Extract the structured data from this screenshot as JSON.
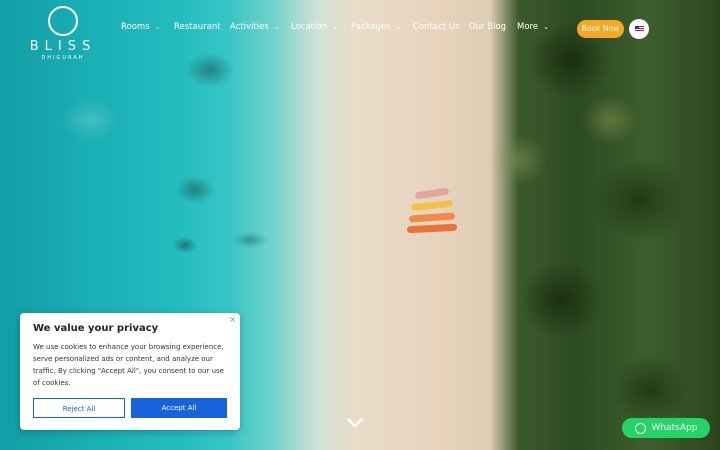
{
  "brand": {
    "name": "BLISS",
    "sub": "DHIGURAH"
  },
  "nav": {
    "items": [
      {
        "label": "Rooms",
        "dropdown": true
      },
      {
        "label": "Restaurant",
        "dropdown": false
      },
      {
        "label": "Activities",
        "dropdown": true
      },
      {
        "label": "Location",
        "dropdown": true
      },
      {
        "label": "Packages",
        "dropdown": true
      },
      {
        "label": "Contact Us",
        "dropdown": false
      },
      {
        "label": "Our Blog",
        "dropdown": false
      },
      {
        "label": "More",
        "dropdown": true
      }
    ],
    "book_label": "Book Now",
    "language": "en-US"
  },
  "cookie": {
    "close": "×",
    "title": "We value your privacy",
    "text": "We use cookies to enhance your browsing experience, serve personalized ads or content, and analyze our traffic. By clicking \"Accept All\", you consent to our use of cookies.",
    "reject_label": "Reject All",
    "accept_label": "Accept All"
  },
  "whatsapp": {
    "label": "WhatsApp"
  },
  "colors": {
    "accent": "#f4a823",
    "cookie_button": "#1863dc",
    "whatsapp": "#25d366"
  },
  "icons": {
    "scroll": "chevron-down-icon",
    "language": "us-flag-icon",
    "chat": "whatsapp-icon"
  }
}
